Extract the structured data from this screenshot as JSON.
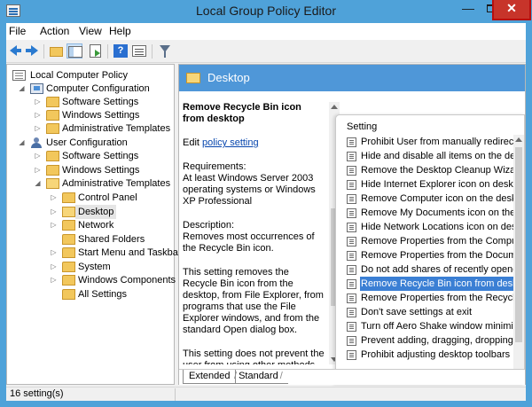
{
  "window": {
    "title": "Local Group Policy Editor",
    "minimize_glyph": "—",
    "close_glyph": "✕"
  },
  "menu": [
    "File",
    "Action",
    "View",
    "Help"
  ],
  "toolbar": {
    "icons": [
      "back-arrow-icon",
      "forward-arrow-icon",
      "up-folder-icon",
      "show-hide-tree-icon",
      "export-list-icon",
      "help-icon",
      "properties-icon",
      "filter-icon"
    ]
  },
  "tree": {
    "root": "Local Computer Policy",
    "computer_configuration": "Computer Configuration",
    "cc_software_settings": "Software Settings",
    "cc_windows_settings": "Windows Settings",
    "cc_admin_templates": "Administrative Templates",
    "user_configuration": "User Configuration",
    "uc_software_settings": "Software Settings",
    "uc_windows_settings": "Windows Settings",
    "uc_admin_templates": "Administrative Templates",
    "control_panel": "Control Panel",
    "desktop": "Desktop",
    "network": "Network",
    "shared_folders": "Shared Folders",
    "start_menu": "Start Menu and Taskbar",
    "system": "System",
    "windows_components": "Windows Components",
    "all_settings": "All Settings"
  },
  "right": {
    "header": "Desktop",
    "description": {
      "title": "Remove Recycle Bin icon from desktop",
      "edit_prefix": "Edit ",
      "edit_link": "policy setting",
      "requirements": "Requirements:\nAt least Windows Server 2003 operating systems or Windows XP Professional",
      "description": "Description:\nRemoves most occurrences of the Recycle Bin icon.",
      "para2": "This setting removes the Recycle Bin icon from the desktop, from File Explorer, from programs that use the File Explorer windows, and from the standard Open dialog box.",
      "para3": "This setting does not prevent the user from using other methods to"
    },
    "list_header": "Setting",
    "settings": [
      "Prohibit User from manually redirecting",
      "Hide and disable all items on the deskto",
      "Remove the Desktop Cleanup Wizard",
      "Hide Internet Explorer icon on desktop",
      "Remove Computer icon on the desktop",
      "Remove My Documents icon on the desk",
      "Hide Network Locations icon on deskto",
      "Remove Properties from the Computer",
      "Remove Properties from the Document",
      "Do not add shares of recently opened d",
      "Remove Recycle Bin icon from desktop",
      "Remove Properties from the Recycle Bin",
      "Don't save settings at exit",
      "Turn off Aero Shake window minimizin",
      "Prevent adding, dragging, dropping an",
      "Prohibit adjusting desktop toolbars"
    ],
    "tabs": [
      "Extended",
      "Standard"
    ]
  },
  "status": "16 setting(s)"
}
